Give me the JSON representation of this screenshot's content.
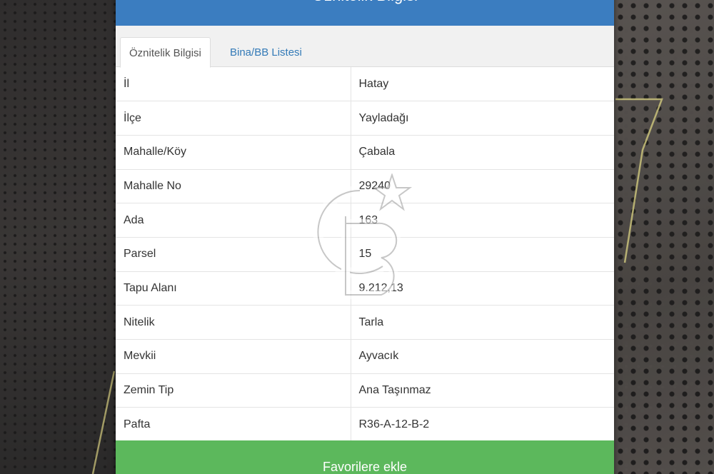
{
  "modal": {
    "title": "Öznitelik Bilgisi",
    "close_glyph": "×",
    "icons": {
      "menu": "kebab-menu-icon",
      "close": "close-icon"
    }
  },
  "tabs": [
    {
      "label": "Öznitelik Bilgisi",
      "active": true
    },
    {
      "label": "Bina/BB Listesi",
      "active": false
    }
  ],
  "attributes": [
    {
      "key": "İl",
      "value": "Hatay"
    },
    {
      "key": "İlçe",
      "value": "Yayladağı"
    },
    {
      "key": "Mahalle/Köy",
      "value": "Çabala"
    },
    {
      "key": "Mahalle No",
      "value": "29240"
    },
    {
      "key": "Ada",
      "value": "163"
    },
    {
      "key": "Parsel",
      "value": "15"
    },
    {
      "key": "Tapu Alanı",
      "value": "9.212,13"
    },
    {
      "key": "Nitelik",
      "value": "Tarla"
    },
    {
      "key": "Mevkii",
      "value": "Ayvacık"
    },
    {
      "key": "Zemin Tip",
      "value": "Ana Taşınmaz"
    },
    {
      "key": "Pafta",
      "value": "R36-A-12-B-2"
    }
  ],
  "favorite_button": {
    "label": "Favorilere ekle"
  },
  "colors": {
    "header": "#3b7dc0",
    "tab_link": "#337ab7",
    "favorite_button": "#5cb85c",
    "parcel_outline": "#c9c27a"
  }
}
